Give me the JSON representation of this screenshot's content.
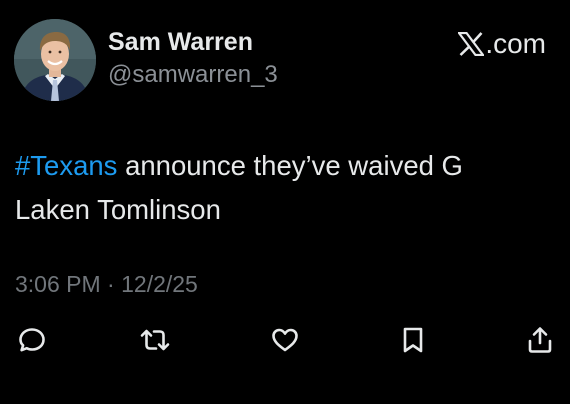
{
  "author": {
    "display_name": "Sam Warren",
    "handle": "@samwarren_3",
    "avatar_icon": "profile-photo"
  },
  "brand": {
    "logo_icon": "x-logo-icon",
    "text": ".com"
  },
  "tweet": {
    "hashtag": "#Texans",
    "line1": " announce they’ve waived G",
    "line2": "Laken Tomlinson"
  },
  "meta": {
    "time": "3:06 PM",
    "separator": " · ",
    "date": "12/2/25"
  },
  "actions": [
    {
      "name": "reply",
      "icon": "reply-icon"
    },
    {
      "name": "repost",
      "icon": "repost-icon"
    },
    {
      "name": "like",
      "icon": "heart-icon"
    },
    {
      "name": "bookmark",
      "icon": "bookmark-icon"
    },
    {
      "name": "share",
      "icon": "share-icon"
    }
  ],
  "colors": {
    "background": "#000000",
    "text": "#e7e9ea",
    "secondary": "#71767b",
    "hashtag": "#1d9bf0"
  }
}
